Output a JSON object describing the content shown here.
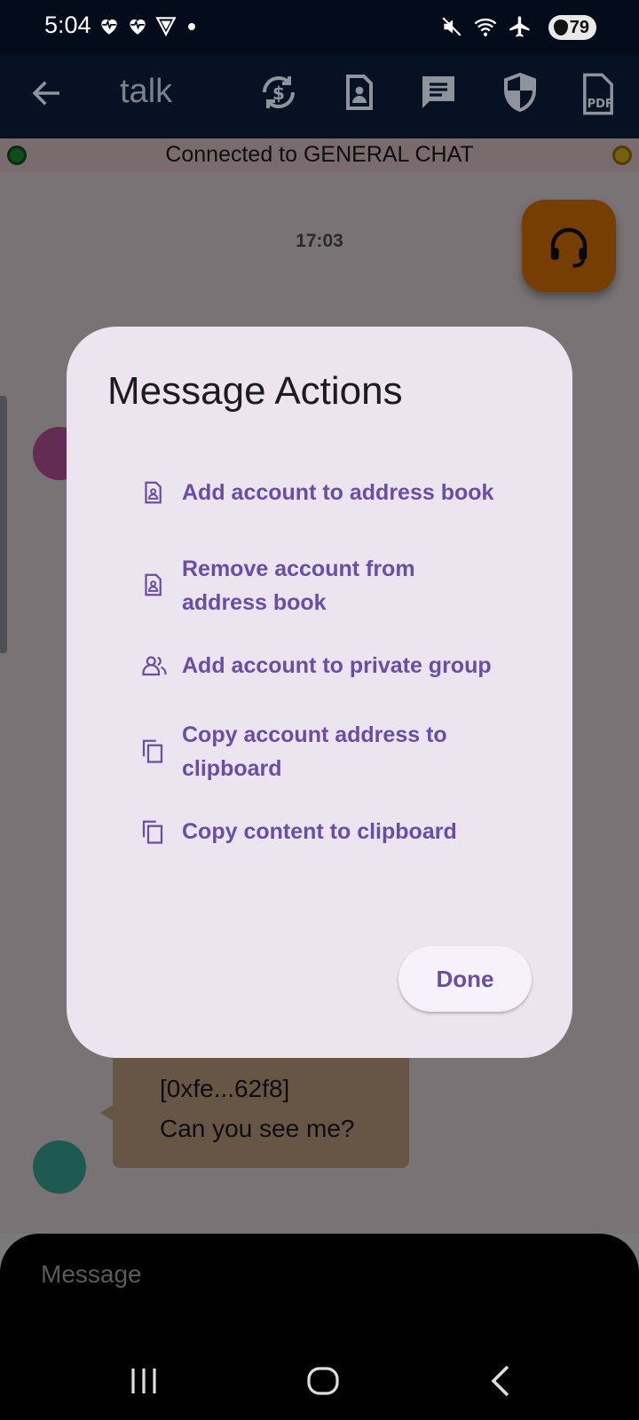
{
  "status_bar": {
    "time": "5:04",
    "battery": "79",
    "left_icons": [
      "heartbeat-icon",
      "heartbeat-icon",
      "vpn-shield-icon",
      "dot-icon"
    ],
    "right_icons": [
      "mute-icon",
      "wifi-icon",
      "airplane-icon"
    ]
  },
  "app_bar": {
    "title": "talk",
    "actions": [
      "sync-dollar-icon",
      "contact-card-icon",
      "chat-icon",
      "shield-icon",
      "pdf-icon"
    ]
  },
  "chat": {
    "connection_status": "Connected to GENERAL CHAT",
    "timestamp": "17:03",
    "message": {
      "sender": "[0xfe...62f8]",
      "text": "Can you see me?"
    },
    "compose_placeholder": "Message"
  },
  "dialog": {
    "title": "Message Actions",
    "actions": [
      {
        "label": "Add account to address book",
        "icon": "contact-card-icon"
      },
      {
        "label": "Remove account from address book",
        "icon": "contact-card-icon"
      },
      {
        "label": "Add account to private group",
        "icon": "group-icon"
      },
      {
        "label": "Copy account address to clipboard",
        "icon": "copy-icon"
      },
      {
        "label": "Copy content to clipboard",
        "icon": "copy-icon"
      }
    ],
    "done_label": "Done"
  },
  "colors": {
    "accent": "#6a4ea6",
    "dialog_bg": "#ece5ef",
    "app_bar_bg": "#061223",
    "support_fab": "#ee7d08"
  }
}
